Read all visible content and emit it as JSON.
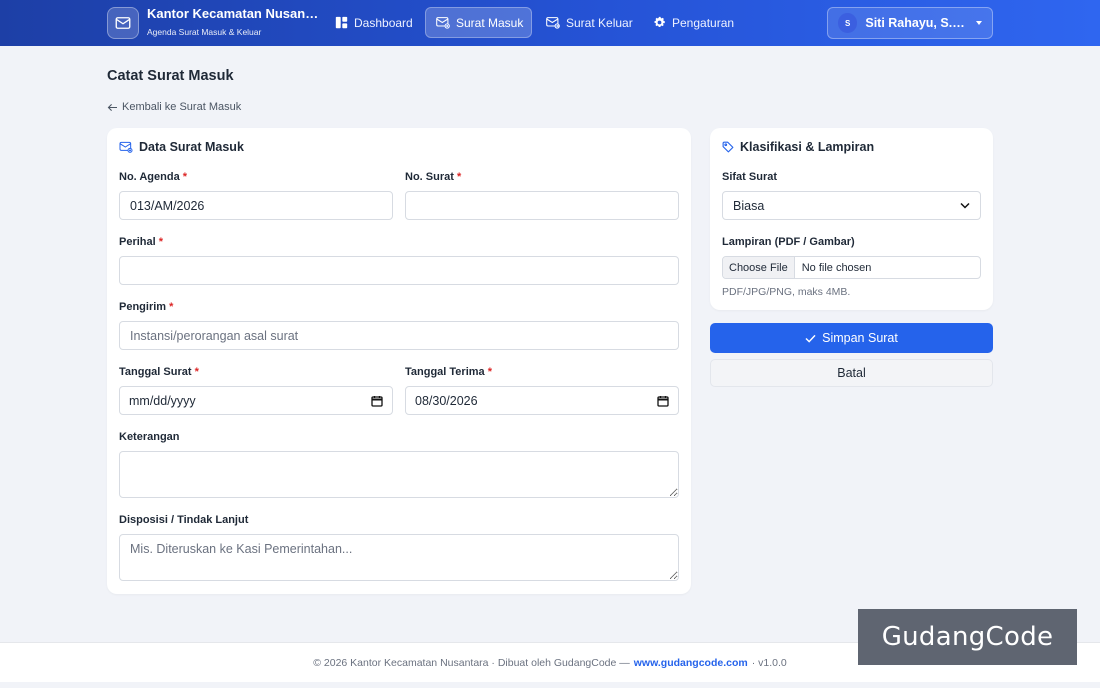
{
  "navbar": {
    "brand_title": "Kantor Kecamatan Nusan…",
    "brand_subtitle": "Agenda Surat Masuk & Keluar",
    "items": [
      {
        "label": "Dashboard",
        "icon": "dashboard-icon",
        "active": false
      },
      {
        "label": "Surat Masuk",
        "icon": "inbox-mail-icon",
        "active": true
      },
      {
        "label": "Surat Keluar",
        "icon": "outbox-mail-icon",
        "active": false
      },
      {
        "label": "Pengaturan",
        "icon": "gear-icon",
        "active": false
      }
    ],
    "user": {
      "initial": "S",
      "name": "Siti Rahayu, S.A…"
    }
  },
  "page": {
    "title": "Catat Surat Masuk",
    "back_label": "Kembali ke Surat Masuk"
  },
  "form": {
    "heading": "Data Surat Masuk",
    "no_agenda": {
      "label": "No. Agenda",
      "value": "013/AM/2026"
    },
    "no_surat": {
      "label": "No. Surat",
      "value": ""
    },
    "perihal": {
      "label": "Perihal",
      "value": ""
    },
    "pengirim": {
      "label": "Pengirim",
      "value": "",
      "placeholder": "Instansi/perorangan asal surat"
    },
    "tanggal_surat": {
      "label": "Tanggal Surat",
      "value": "mm/dd/yyyy"
    },
    "tanggal_terima": {
      "label": "Tanggal Terima",
      "value": "08/30/2026"
    },
    "keterangan": {
      "label": "Keterangan",
      "value": ""
    },
    "disposisi": {
      "label": "Disposisi / Tindak Lanjut",
      "value": "",
      "placeholder": "Mis. Diteruskan ke Kasi Pemerintahan..."
    },
    "required_mark": "*"
  },
  "klasifikasi": {
    "heading": "Klasifikasi & Lampiran",
    "sifat": {
      "label": "Sifat Surat",
      "selected": "Biasa"
    },
    "lampiran": {
      "label": "Lampiran (PDF / Gambar)",
      "button": "Choose File",
      "file_name": "No file chosen",
      "hint": "PDF/JPG/PNG, maks 4MB."
    }
  },
  "actions": {
    "save": "Simpan Surat",
    "cancel": "Batal"
  },
  "footer": {
    "prefix": "© 2026 Kantor Kecamatan Nusantara · Dibuat oleh GudangCode —",
    "link": "www.gudangcode.com",
    "suffix": "· v1.0.0"
  },
  "watermark": "GudangCode",
  "colors": {
    "primary": "#2563eb",
    "navbar": "#2553d6",
    "required": "#dc2626"
  }
}
